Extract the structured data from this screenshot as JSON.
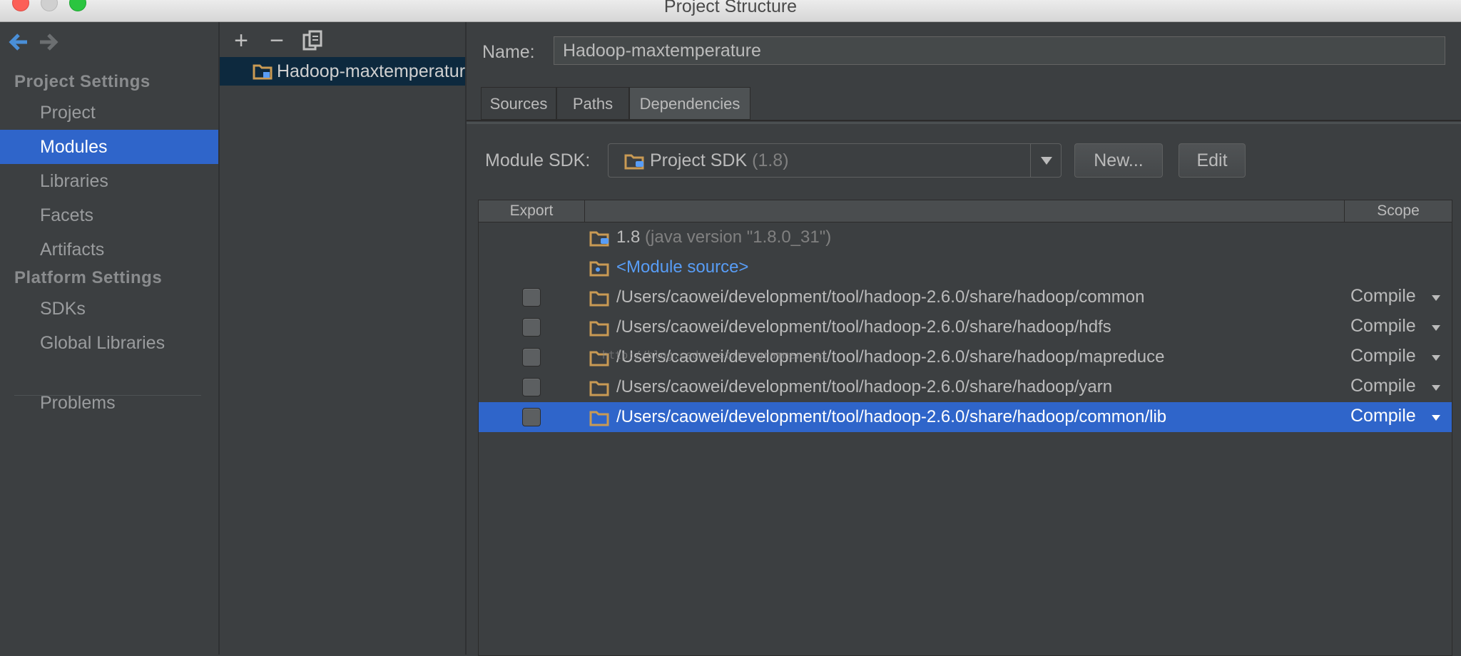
{
  "window": {
    "title": "Project Structure"
  },
  "nav": {
    "back_icon": "back-arrow-icon",
    "forward_icon": "forward-arrow-icon",
    "project_settings_header": "Project Settings",
    "project_settings_items": [
      "Project",
      "Modules",
      "Libraries",
      "Facets",
      "Artifacts"
    ],
    "platform_settings_header": "Platform Settings",
    "platform_settings_items": [
      "SDKs",
      "Global Libraries"
    ],
    "problems": "Problems",
    "selected": "Modules"
  },
  "modules": {
    "toolbar": {
      "add": "+",
      "remove": "−",
      "copy_icon": "copy-icon"
    },
    "items": [
      "Hadoop-maxtemperature"
    ]
  },
  "module_detail": {
    "name_label": "Name:",
    "name_value": "Hadoop-maxtemperature",
    "tabs": [
      "Sources",
      "Paths",
      "Dependencies"
    ],
    "active_tab": "Dependencies",
    "sdk_label": "Module SDK:",
    "sdk_value": "Project SDK",
    "sdk_version": "(1.8)",
    "new_button": "New...",
    "edit_button": "Edit"
  },
  "dependencies": {
    "headers": {
      "export": "Export",
      "name": "",
      "scope": "Scope"
    },
    "rows": [
      {
        "name": "1.8",
        "note": "(java version \"1.8.0_31\")",
        "type": "sdk"
      },
      {
        "name": "<Module source>",
        "type": "source"
      },
      {
        "name": "/Users/caowei/development/tool/hadoop-2.6.0/share/hadoop/common",
        "scope": "Compile",
        "type": "library"
      },
      {
        "name": "/Users/caowei/development/tool/hadoop-2.6.0/share/hadoop/hdfs",
        "scope": "Compile",
        "type": "library"
      },
      {
        "name": "/Users/caowei/development/tool/hadoop-2.6.0/share/hadoop/mapreduce",
        "scope": "Compile",
        "type": "library"
      },
      {
        "name": "/Users/caowei/development/tool/hadoop-2.6.0/share/hadoop/yarn",
        "scope": "Compile",
        "type": "library"
      },
      {
        "name": "/Users/caowei/development/tool/hadoop-2.6.0/share/hadoop/common/lib",
        "scope": "Compile",
        "type": "library",
        "selected": true
      }
    ],
    "watermark": "http://blog.csdn.net/programmer_wei"
  },
  "colors": {
    "selection": "#2f65ca",
    "link": "#589df6",
    "folder": "#c99a54"
  }
}
